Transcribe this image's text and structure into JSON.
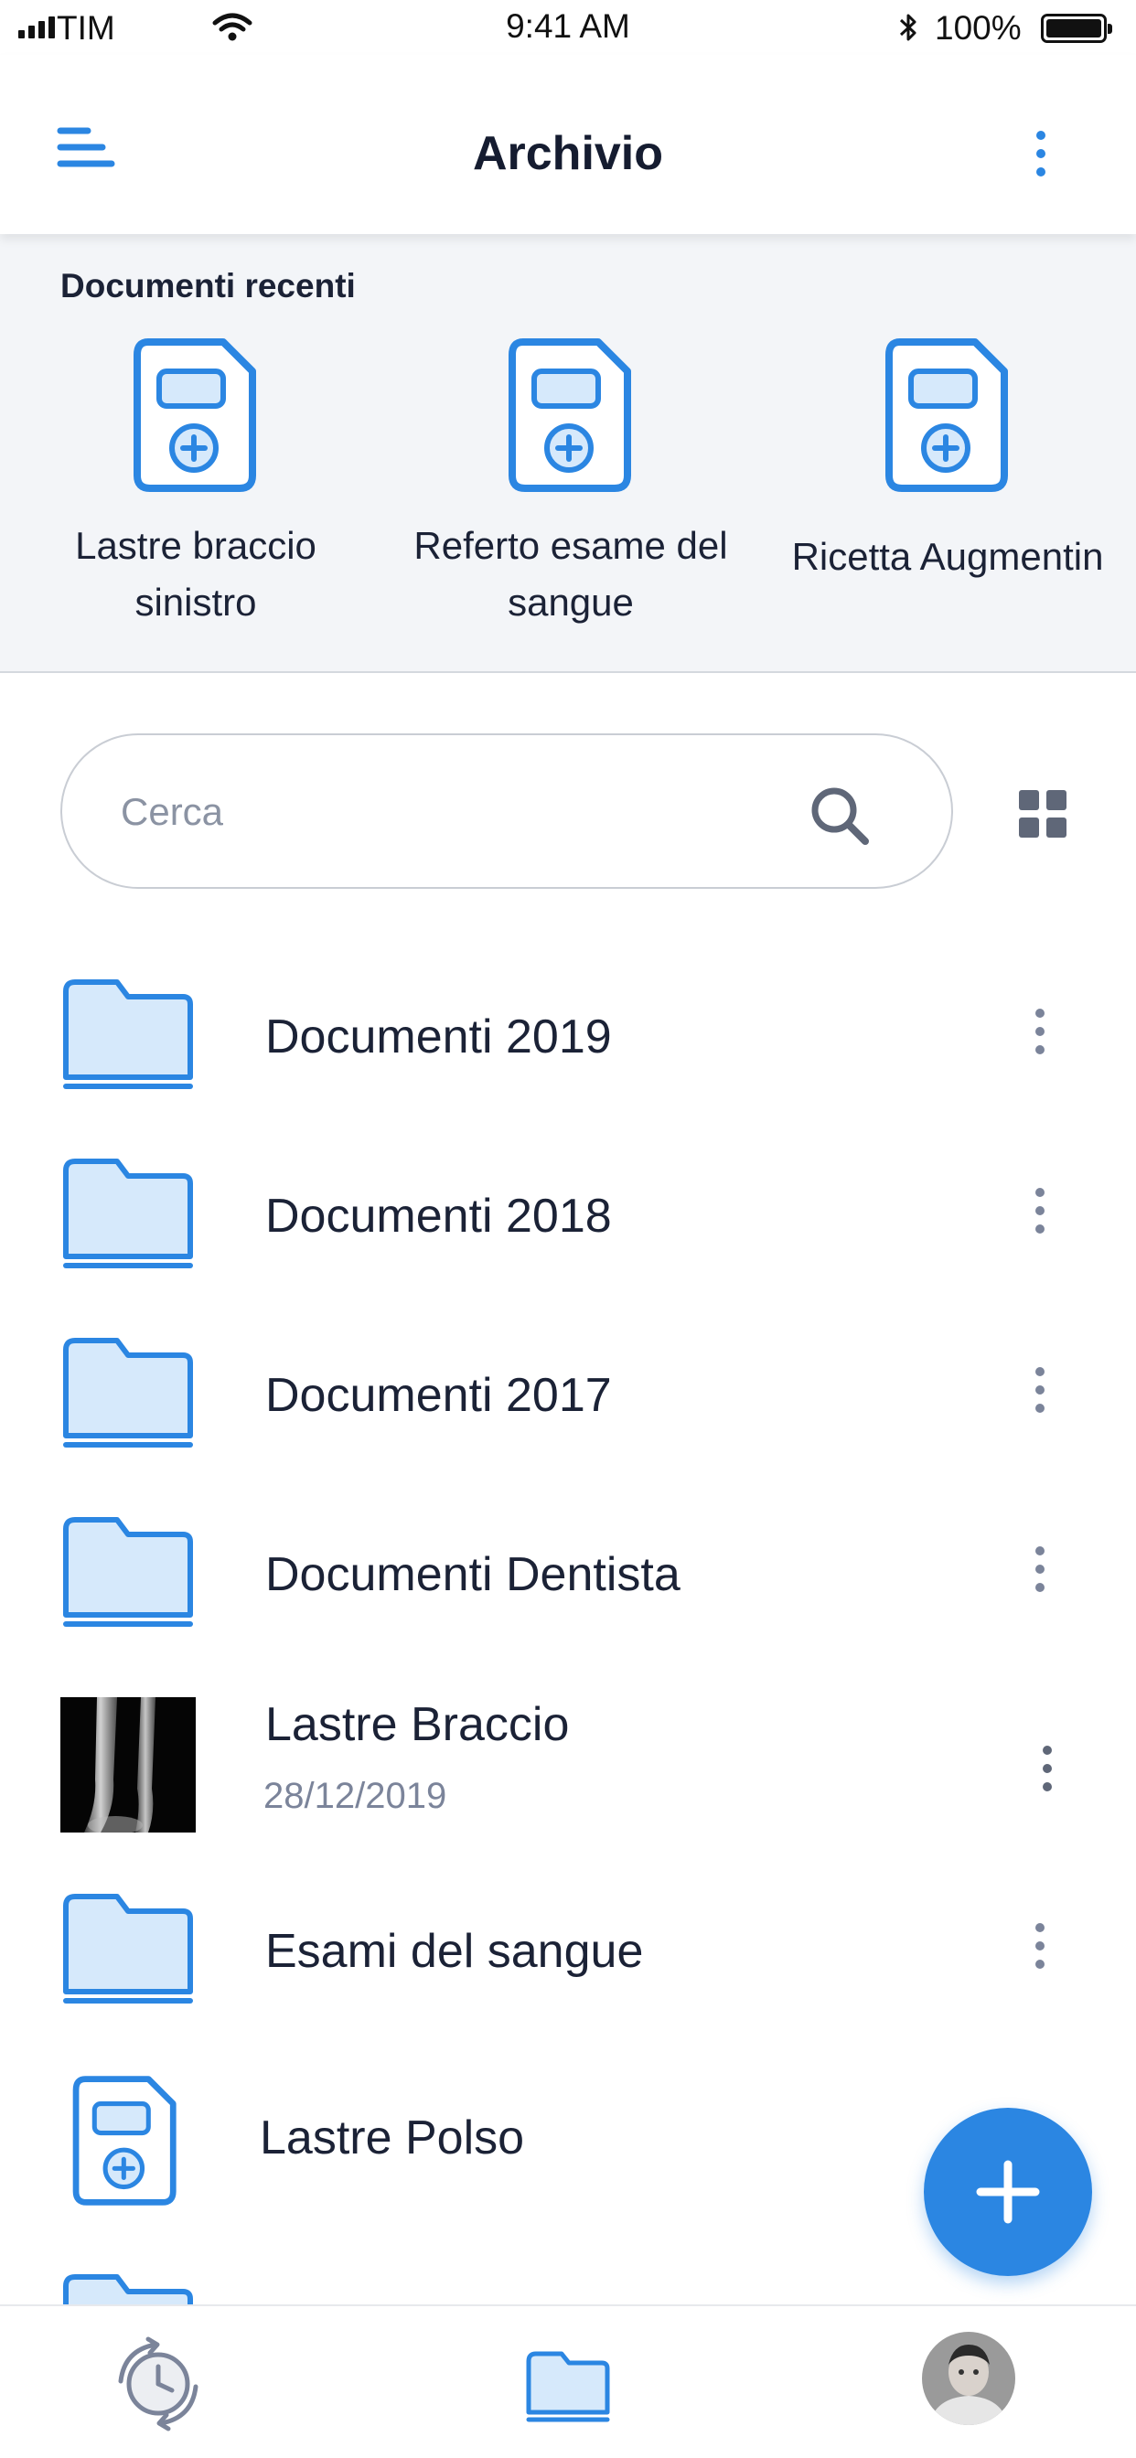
{
  "status_bar": {
    "carrier": "TIM",
    "time": "9:41 AM",
    "battery": "100%"
  },
  "header": {
    "title": "Archivio",
    "menu_icon": "menu-icon",
    "more_icon": "more-vertical-icon"
  },
  "recent": {
    "title": "Documenti recenti",
    "items": [
      {
        "label": "Lastre braccio sinistro",
        "icon": "medical-document-icon"
      },
      {
        "label": "Referto esame del sangue",
        "icon": "medical-document-icon"
      },
      {
        "label": "Ricetta Augmentin",
        "icon": "medical-document-icon"
      }
    ]
  },
  "search": {
    "placeholder": "Cerca",
    "value": ""
  },
  "list": {
    "items": [
      {
        "name": "Documenti 2019",
        "type": "folder"
      },
      {
        "name": "Documenti 2018",
        "type": "folder"
      },
      {
        "name": "Documenti 2017",
        "type": "folder"
      },
      {
        "name": "Documenti Dentista",
        "type": "folder"
      },
      {
        "name": "Lastre Braccio",
        "date": "28/12/2019",
        "type": "image"
      },
      {
        "name": "Esami del sangue",
        "type": "folder"
      },
      {
        "name": "Lastre Polso",
        "type": "document"
      }
    ]
  },
  "bottom_nav": {
    "items": [
      "history-icon",
      "folder-icon",
      "profile-avatar"
    ],
    "active": "folder-icon"
  },
  "colors": {
    "accent": "#2b86e2",
    "folder_fill": "#d6e9fb",
    "text": "#1b2236",
    "muted": "#7b849a",
    "section_bg": "#f3f5f8"
  }
}
